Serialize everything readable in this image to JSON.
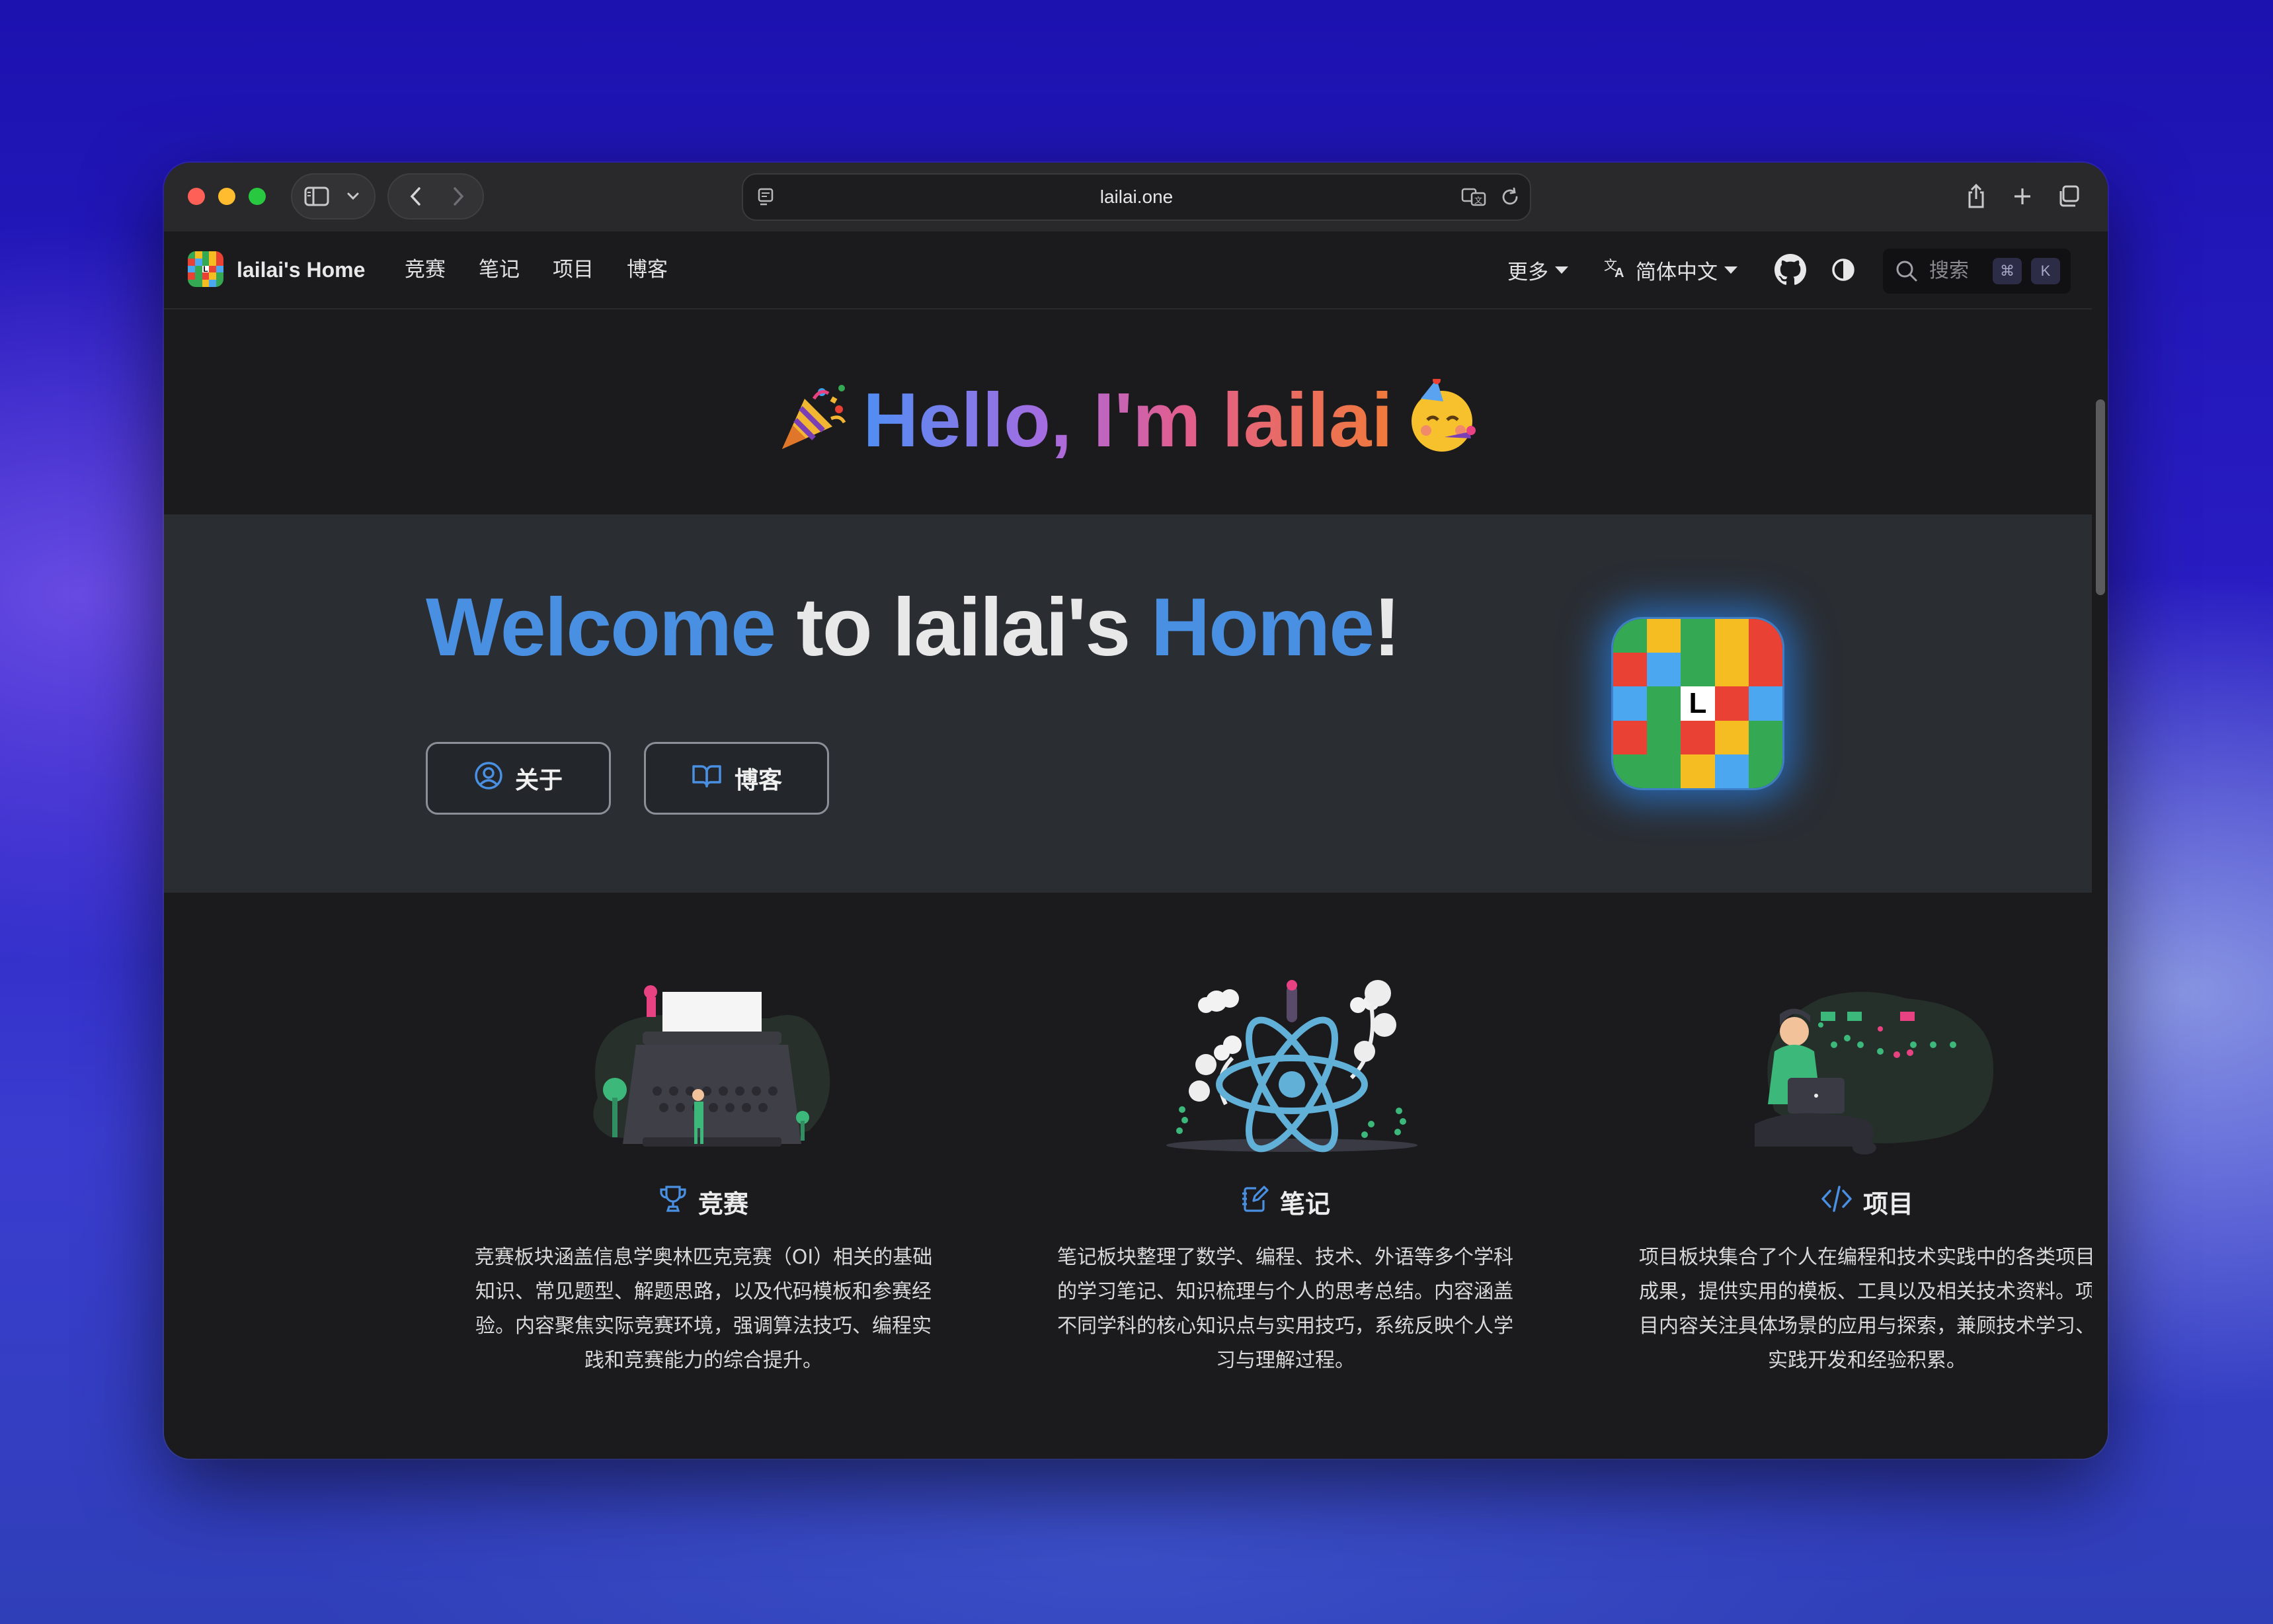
{
  "browser": {
    "url": "lailai.one"
  },
  "nav": {
    "brand": "lailai's Home",
    "links": [
      "竞赛",
      "笔记",
      "项目",
      "博客"
    ],
    "more": "更多",
    "language": "简体中文",
    "search_placeholder": "搜索",
    "shortcut_keys": [
      "⌘",
      "K"
    ]
  },
  "hero": {
    "hello": "Hello, I'm lailai",
    "welcome_parts": [
      "Welcome",
      " to lailai's ",
      "Home",
      "!"
    ],
    "buttons": [
      {
        "label": "关于",
        "icon": "user-circle-icon"
      },
      {
        "label": "博客",
        "icon": "book-open-icon"
      }
    ]
  },
  "logo": {
    "letter": "L",
    "colors": [
      "#e94235",
      "#f6bd23",
      "#4aa7f0",
      "#34a853"
    ]
  },
  "features": [
    {
      "title": "竞赛",
      "icon": "trophy-icon",
      "desc_lines": [
        "竞赛板块涵盖信息学奥林匹克竞赛（OI）相关的基础",
        "知识、常见题型、解题思路，以及代码模板和参赛经",
        "验。内容聚焦实际竞赛环境，强调算法技巧、编程实",
        "践和竞赛能力的综合提升。"
      ]
    },
    {
      "title": "笔记",
      "icon": "notebook-pen-icon",
      "desc_lines": [
        "笔记板块整理了数学、编程、技术、外语等多个学科",
        "的学习笔记、知识梳理与个人的思考总结。内容涵盖",
        "不同学科的核心知识点与实用技巧，系统反映个人学",
        "习与理解过程。"
      ]
    },
    {
      "title": "项目",
      "icon": "code-icon",
      "desc_lines": [
        "项目板块集合了个人在编程和技术实践中的各类项目",
        "成果，提供实用的模板、工具以及相关技术资料。项",
        "目内容关注具体场景的应用与探索，兼顾技术学习、",
        "实践开发和经验积累。"
      ]
    }
  ],
  "colors": {
    "accent": "#4a90e2",
    "page_bg": "#1b1b1d",
    "welcome_bg": "#2a2d32"
  }
}
